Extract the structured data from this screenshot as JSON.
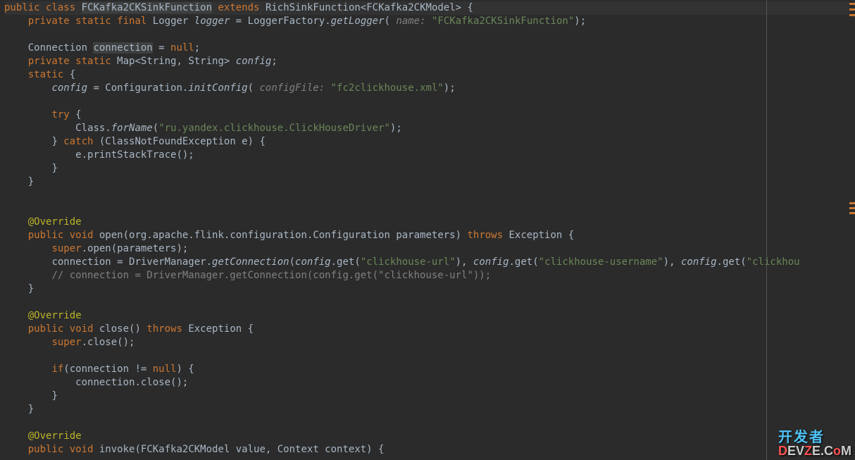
{
  "code": {
    "l1_public": "public",
    "l1_class": "class",
    "l1_name": "FCKafka2CKSinkFunction",
    "l1_extends": "extends",
    "l1_parent": "RichSinkFunction<FCKafka2CKModel> {",
    "l2_private": "private",
    "l2_static": "static",
    "l2_final": "final",
    "l2_type": "Logger",
    "l2_var": "logger",
    "l2_eq": " = LoggerFactory.",
    "l2_method": "getLogger",
    "l2_paren": "(",
    "l2_param": " name: ",
    "l2_str": "\"FCKafka2CKSinkFunction\"",
    "l2_end": ");",
    "l4a": "Connection ",
    "l4_conn": "connection",
    "l4b": " = ",
    "l4_null": "null",
    "l4c": ";",
    "l5_private": "private",
    "l5_static": "static",
    "l5_type": " Map<String, String> ",
    "l5_var": "config",
    "l5_end": ";",
    "l6_static": "static",
    "l6_brace": " {",
    "l7_var": "config",
    "l7_a": " = Configuration.",
    "l7_method": "initConfig",
    "l7_paren": "(",
    "l7_param": " configFile: ",
    "l7_str": "\"fc2clickhouse.xml\"",
    "l7_end": ");",
    "l9_try": "try",
    "l9_brace": " {",
    "l10_a": "Class.",
    "l10_method": "forName",
    "l10_paren": "(",
    "l10_str": "\"ru.yandex.clickhouse.ClickHouseDriver\"",
    "l10_end": ");",
    "l11_brace": "} ",
    "l11_catch": "catch",
    "l11_rest": " (ClassNotFoundException e) {",
    "l12": "e.printStackTrace();",
    "l13": "}",
    "l14": "}",
    "l17_anno": "@Override",
    "l18_public": "public",
    "l18_void": "void",
    "l18_method": " open(org.apache.flink.configuration.Configuration parameters) ",
    "l18_throws": "throws",
    "l18_exc": " Exception {",
    "l19_super": "super",
    "l19_rest": ".open(parameters);",
    "l20_a": "connection = DriverManager.",
    "l20_method": "getConnection",
    "l20_paren": "(",
    "l20_cfg1": "config",
    "l20_get1": ".get(",
    "l20_str1": "\"clickhouse-url\"",
    "l20_c1": "), ",
    "l20_cfg2": "config",
    "l20_get2": ".get(",
    "l20_str2": "\"clickhouse-username\"",
    "l20_c2": "), ",
    "l20_cfg3": "config",
    "l20_get3": ".get(",
    "l20_str3": "\"clickhou",
    "l21_comment": "// connection = DriverManager.getConnection(config.get(\"clickhouse-url\"));",
    "l22": "}",
    "l24_anno": "@Override",
    "l25_public": "public",
    "l25_void": "void",
    "l25_method": " close() ",
    "l25_throws": "throws",
    "l25_exc": " Exception {",
    "l26_super": "super",
    "l26_rest": ".close();",
    "l28_if": "if",
    "l28_paren": "(connection != ",
    "l28_null": "null",
    "l28_end": ") {",
    "l29": "connection.close();",
    "l30": "}",
    "l31": "}",
    "l33_anno": "@Override",
    "l34_public": "public",
    "l34_void": "void",
    "l34_method": " invoke(FCKafka2CKModel value, Context context) {"
  },
  "watermark": {
    "l1": "开发者",
    "l2a": "D",
    "l2b": "EV",
    "l2c": "Z",
    "l2d": "E.C",
    "l2e": "o",
    "l2f": "M"
  }
}
